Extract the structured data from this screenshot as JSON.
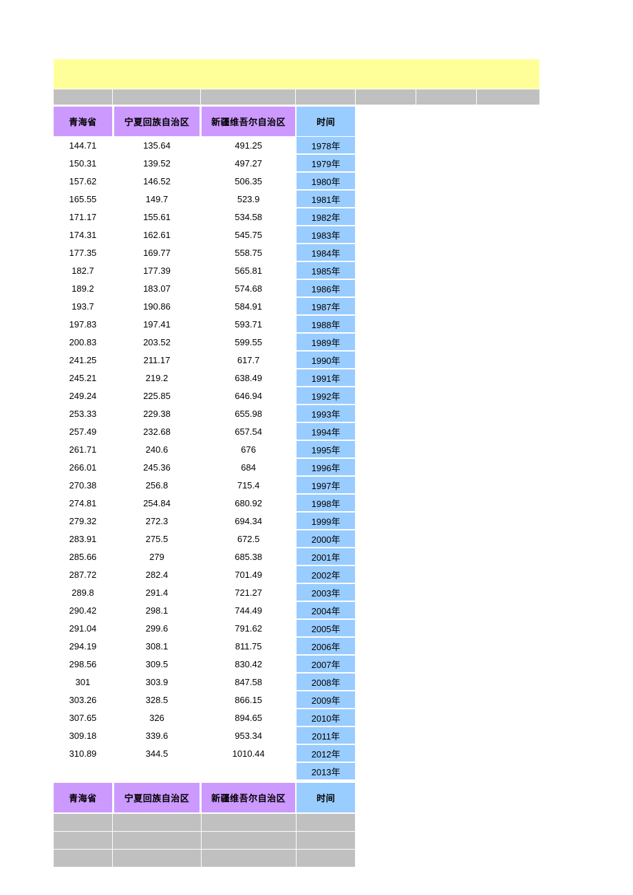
{
  "banner": {
    "text": "",
    "color": "#ffff99"
  },
  "colors": {
    "banner_yellow": "#ffff99",
    "header_purple": "#cc99ff",
    "time_blue": "#99ccff",
    "filler_gray": "#c0c0c0",
    "text": "#000000",
    "background": "#ffffff"
  },
  "table": {
    "headers": [
      "青海省",
      "宁夏回族自治区",
      "新疆维吾尔自治区",
      "时间"
    ],
    "rows": [
      {
        "qinghai": "144.71",
        "ningxia": "135.64",
        "xinjiang": "491.25",
        "year": "1978年"
      },
      {
        "qinghai": "150.31",
        "ningxia": "139.52",
        "xinjiang": "497.27",
        "year": "1979年"
      },
      {
        "qinghai": "157.62",
        "ningxia": "146.52",
        "xinjiang": "506.35",
        "year": "1980年"
      },
      {
        "qinghai": "165.55",
        "ningxia": "149.7",
        "xinjiang": "523.9",
        "year": "1981年"
      },
      {
        "qinghai": "171.17",
        "ningxia": "155.61",
        "xinjiang": "534.58",
        "year": "1982年"
      },
      {
        "qinghai": "174.31",
        "ningxia": "162.61",
        "xinjiang": "545.75",
        "year": "1983年"
      },
      {
        "qinghai": "177.35",
        "ningxia": "169.77",
        "xinjiang": "558.75",
        "year": "1984年"
      },
      {
        "qinghai": "182.7",
        "ningxia": "177.39",
        "xinjiang": "565.81",
        "year": "1985年"
      },
      {
        "qinghai": "189.2",
        "ningxia": "183.07",
        "xinjiang": "574.68",
        "year": "1986年"
      },
      {
        "qinghai": "193.7",
        "ningxia": "190.86",
        "xinjiang": "584.91",
        "year": "1987年"
      },
      {
        "qinghai": "197.83",
        "ningxia": "197.41",
        "xinjiang": "593.71",
        "year": "1988年"
      },
      {
        "qinghai": "200.83",
        "ningxia": "203.52",
        "xinjiang": "599.55",
        "year": "1989年"
      },
      {
        "qinghai": "241.25",
        "ningxia": "211.17",
        "xinjiang": "617.7",
        "year": "1990年"
      },
      {
        "qinghai": "245.21",
        "ningxia": "219.2",
        "xinjiang": "638.49",
        "year": "1991年"
      },
      {
        "qinghai": "249.24",
        "ningxia": "225.85",
        "xinjiang": "646.94",
        "year": "1992年"
      },
      {
        "qinghai": "253.33",
        "ningxia": "229.38",
        "xinjiang": "655.98",
        "year": "1993年"
      },
      {
        "qinghai": "257.49",
        "ningxia": "232.68",
        "xinjiang": "657.54",
        "year": "1994年"
      },
      {
        "qinghai": "261.71",
        "ningxia": "240.6",
        "xinjiang": "676",
        "year": "1995年"
      },
      {
        "qinghai": "266.01",
        "ningxia": "245.36",
        "xinjiang": "684",
        "year": "1996年"
      },
      {
        "qinghai": "270.38",
        "ningxia": "256.8",
        "xinjiang": "715.4",
        "year": "1997年"
      },
      {
        "qinghai": "274.81",
        "ningxia": "254.84",
        "xinjiang": "680.92",
        "year": "1998年"
      },
      {
        "qinghai": "279.32",
        "ningxia": "272.3",
        "xinjiang": "694.34",
        "year": "1999年"
      },
      {
        "qinghai": "283.91",
        "ningxia": "275.5",
        "xinjiang": "672.5",
        "year": "2000年"
      },
      {
        "qinghai": "285.66",
        "ningxia": "279",
        "xinjiang": "685.38",
        "year": "2001年"
      },
      {
        "qinghai": "287.72",
        "ningxia": "282.4",
        "xinjiang": "701.49",
        "year": "2002年"
      },
      {
        "qinghai": "289.8",
        "ningxia": "291.4",
        "xinjiang": "721.27",
        "year": "2003年"
      },
      {
        "qinghai": "290.42",
        "ningxia": "298.1",
        "xinjiang": "744.49",
        "year": "2004年"
      },
      {
        "qinghai": "291.04",
        "ningxia": "299.6",
        "xinjiang": "791.62",
        "year": "2005年"
      },
      {
        "qinghai": "294.19",
        "ningxia": "308.1",
        "xinjiang": "811.75",
        "year": "2006年"
      },
      {
        "qinghai": "298.56",
        "ningxia": "309.5",
        "xinjiang": "830.42",
        "year": "2007年"
      },
      {
        "qinghai": "301",
        "ningxia": "303.9",
        "xinjiang": "847.58",
        "year": "2008年"
      },
      {
        "qinghai": "303.26",
        "ningxia": "328.5",
        "xinjiang": "866.15",
        "year": "2009年"
      },
      {
        "qinghai": "307.65",
        "ningxia": "326",
        "xinjiang": "894.65",
        "year": "2010年"
      },
      {
        "qinghai": "309.18",
        "ningxia": "339.6",
        "xinjiang": "953.34",
        "year": "2011年"
      },
      {
        "qinghai": "310.89",
        "ningxia": "344.5",
        "xinjiang": "1010.44",
        "year": "2012年"
      },
      {
        "qinghai": "",
        "ningxia": "",
        "xinjiang": "",
        "year": "2013年"
      }
    ],
    "footer_headers": [
      "青海省",
      "宁夏回族自治区",
      "新疆维吾尔自治区",
      "时间"
    ],
    "trailing_blank_rows": 3
  }
}
